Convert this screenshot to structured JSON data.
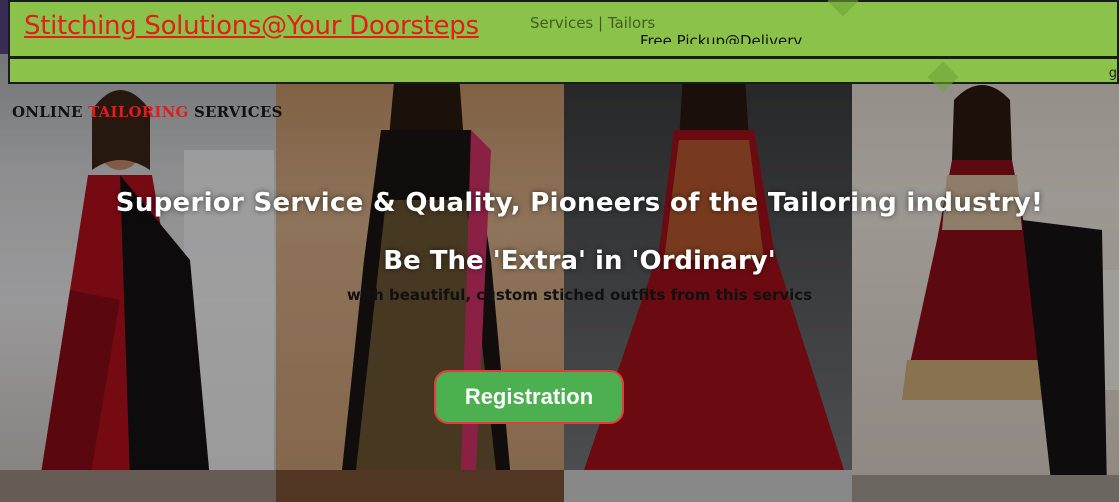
{
  "header": {
    "brand_text": "Stitching Solutions@Your Doorsteps",
    "nav_partial": "Services | Tailors",
    "nav_secondary": "Free Pickup@Delivery",
    "edge_char": "g"
  },
  "hero": {
    "online_label_prefix": "ONLINE ",
    "online_label_highlight": "TAILORING",
    "online_label_suffix": " SERVICES",
    "headline": "Superior Service & Quality, Pioneers of the Tailoring industry!",
    "subheadline": "Be The 'Extra' in 'Ordinary'",
    "description": "with beautiful, custom stiched outfits from this servics",
    "register_button_label": "Registration"
  },
  "colors": {
    "topbar_bg": "#8bc34a",
    "brand_red": "#e41c1c",
    "button_green": "#4caf50",
    "button_border": "#e43c3c"
  }
}
